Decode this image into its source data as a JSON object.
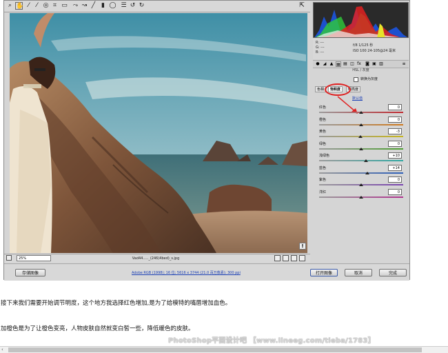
{
  "toolbar": {
    "tools": [
      "zoom-icon",
      "hand-icon",
      "white-balance-icon",
      "color-sampler-icon",
      "target-adjust-icon",
      "crop-icon",
      "straighten-icon",
      "spot-removal-icon",
      "red-eye-icon",
      "adjustment-brush-icon",
      "graduated-filter-icon",
      "radial-filter-icon",
      "preferences-icon",
      "rotate-ccw-icon",
      "rotate-cw-icon"
    ]
  },
  "readouts": {
    "rgb": [
      "R: ---",
      "G: ---",
      "B: ---"
    ],
    "exposure": "f/8   1/125 秒",
    "iso": "ISO 100   24-105@24 毫米"
  },
  "panel": {
    "title": "HSL / 灰度",
    "gray_label": "转换为灰度",
    "subtabs": [
      "色相",
      "饱和度",
      "明亮度"
    ],
    "defaults_link": "默认值",
    "sliders": [
      {
        "label": "红色",
        "value": "0",
        "pos": 0.5,
        "color": "#c0262d"
      },
      {
        "label": "橙色",
        "value": "0",
        "pos": 0.5,
        "color": "#d07a1d"
      },
      {
        "label": "黄色",
        "value": "-3",
        "pos": 0.49,
        "color": "#c6b51f"
      },
      {
        "label": "绿色",
        "value": "0",
        "pos": 0.5,
        "color": "#4fa032"
      },
      {
        "label": "浅绿色",
        "value": "+10",
        "pos": 0.56,
        "color": "#2ea7a2"
      },
      {
        "label": "蓝色",
        "value": "+14",
        "pos": 0.57,
        "color": "#2b5db8"
      },
      {
        "label": "紫色",
        "value": "0",
        "pos": 0.5,
        "color": "#7a44b0"
      },
      {
        "label": "洋红",
        "value": "0",
        "pos": 0.5,
        "color": "#b0338f"
      }
    ]
  },
  "status": {
    "zoom": "25%",
    "filename": "Vad44....._(246)4bed)_s.jpg"
  },
  "bottom": {
    "save_label": "存储图像",
    "workflow_link": "Adobe RGB (1998); 16 位; 5616 x 3744 (21.0 百万像素); 300 ppi",
    "open_label": "打开图像",
    "cancel_label": "取消",
    "done_label": "完成"
  },
  "article": {
    "para1": "接下来我们需要开始调节明度，这个地方我选择红色增加,是为了给模特的嘴唇增加血色。",
    "para2": "加橙色是为了让橙色变亮，人物皮肤自然就变白皙一些，降低暖色的皮肤。"
  },
  "watermark": "PhotoShop平面设计吧 【www.lineeg.com/tieba/1783】",
  "colors": {
    "accent": "#e02020",
    "link": "#1a3fb5"
  }
}
